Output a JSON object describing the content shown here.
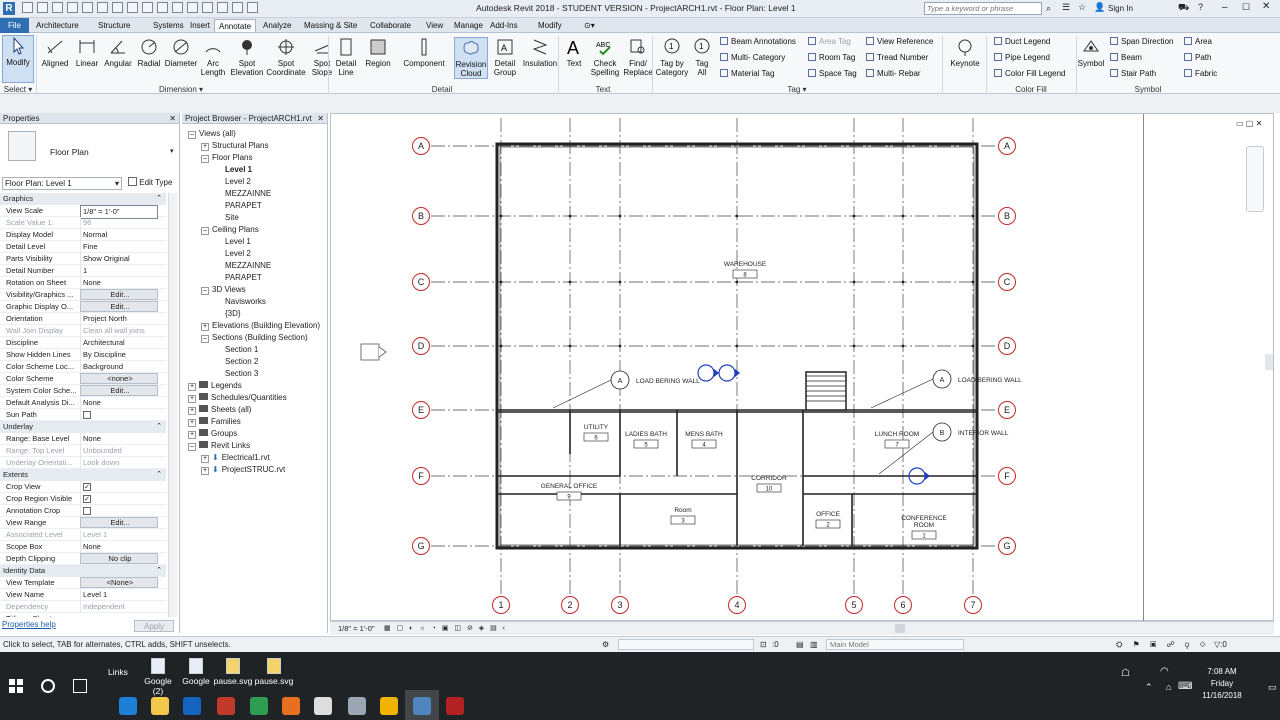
{
  "window": {
    "title": "Autodesk Revit 2018 -  STUDENT VERSION -    ProjectARCH1.rvt - Floor Plan: Level 1",
    "search_placeholder": "Type a keyword or phrase",
    "sign_in": "Sign In"
  },
  "tabs": [
    "File",
    "Architecture",
    "Structure",
    "Systems",
    "Insert",
    "Annotate",
    "Analyze",
    "Massing & Site",
    "Collaborate",
    "View",
    "Manage",
    "Add-Ins",
    "Modify"
  ],
  "active_tab": "Annotate",
  "ribbon": {
    "modify": "Modify",
    "select": "Select",
    "dimension_tools": [
      "Aligned",
      "Linear",
      "Angular",
      "Radial",
      "Diameter",
      "Arc\nLength",
      "Spot\nElevation",
      "Spot\nCoordinate",
      "Spot\nSlope"
    ],
    "dimension_panel": "Dimension",
    "detail_tools": [
      "Detail\nLine",
      "Region",
      "Component",
      "Revision\nCloud",
      "Detail\nGroup",
      "Insulation"
    ],
    "detail_panel": "Detail",
    "text_tools": [
      "Text",
      "Check\nSpelling",
      "Find/\nReplace"
    ],
    "text_panel": "Text",
    "tag_tools": [
      "Tag by\nCategory",
      "Tag\nAll"
    ],
    "tag_small": [
      "Beam  Annotations",
      "Multi- Category",
      "Material  Tag",
      "Area  Tag",
      "Room  Tag",
      "Space  Tag",
      "View  Reference",
      "Tread  Number",
      "Multi- Rebar"
    ],
    "tag_panel": "Tag",
    "keynote": "Keynote",
    "color_fill_small": [
      "Duct  Legend",
      "Pipe  Legend",
      "Color Fill  Legend"
    ],
    "color_fill_panel": "Color Fill",
    "symbol": "Symbol",
    "symbol_small": [
      "Span  Direction",
      "Beam",
      "Stair  Path",
      "Area",
      "Path",
      "Fabric"
    ],
    "symbol_panel": "Symbol"
  },
  "properties": {
    "title": "Properties",
    "type_name": "Floor Plan",
    "instance": "Floor Plan: Level 1",
    "edit_type": "Edit Type",
    "sections": [
      {
        "name": "Graphics",
        "rows": [
          [
            "View Scale",
            "1/8\" = 1'-0\"",
            0
          ],
          [
            "Scale Value    1:",
            "96",
            1
          ],
          [
            "Display Model",
            "Normal",
            0
          ],
          [
            "Detail Level",
            "Fine",
            0
          ],
          [
            "Parts Visibility",
            "Show Original",
            0
          ],
          [
            "Detail Number",
            "1",
            0
          ],
          [
            "Rotation on Sheet",
            "None",
            0
          ],
          [
            "Visibility/Graphics ...",
            "Edit...",
            2
          ],
          [
            "Graphic Display O...",
            "Edit...",
            2
          ],
          [
            "Orientation",
            "Project North",
            0
          ],
          [
            "Wall Join Display",
            "Clean all wall joins",
            1
          ],
          [
            "Discipline",
            "Architectural",
            0
          ],
          [
            "Show Hidden Lines",
            "By Discipline",
            0
          ],
          [
            "Color Scheme Loc...",
            "Background",
            0
          ],
          [
            "Color Scheme",
            "<none>",
            2
          ],
          [
            "System Color Sche...",
            "Edit...",
            2
          ],
          [
            "Default Analysis Di...",
            "None",
            0
          ],
          [
            "Sun Path",
            "",
            3
          ]
        ]
      },
      {
        "name": "Underlay",
        "rows": [
          [
            "Range: Base Level",
            "None",
            0
          ],
          [
            "Range: Top Level",
            "Unbounded",
            1
          ],
          [
            "Underlay Orientati...",
            "Look down",
            1
          ]
        ]
      },
      {
        "name": "Extents",
        "rows": [
          [
            "Crop View",
            "",
            4
          ],
          [
            "Crop Region Visible",
            "",
            4
          ],
          [
            "Annotation Crop",
            "",
            3
          ],
          [
            "View Range",
            "Edit...",
            2
          ],
          [
            "Associated Level",
            "Level 1",
            1
          ],
          [
            "Scope Box",
            "None",
            0
          ],
          [
            "Depth Clipping",
            "No clip",
            2
          ]
        ]
      },
      {
        "name": "Identity Data",
        "rows": [
          [
            "View Template",
            "<None>",
            2
          ],
          [
            "View Name",
            "Level 1",
            0
          ],
          [
            "Dependency",
            "Independent",
            1
          ],
          [
            "Title on Sheet",
            "",
            0
          ]
        ]
      }
    ],
    "help": "Properties help",
    "apply": "Apply"
  },
  "browser": {
    "title": "Project Browser - ProjectARCH1.rvt",
    "nodes": [
      [
        "Views (all)",
        0,
        0
      ],
      [
        "Structural Plans",
        1,
        0
      ],
      [
        "Floor Plans",
        1,
        0
      ],
      [
        "Level 1",
        2,
        1
      ],
      [
        "Level 2",
        2,
        0
      ],
      [
        "MEZZAINNE",
        2,
        0
      ],
      [
        "PARAPET",
        2,
        0
      ],
      [
        "Site",
        2,
        0
      ],
      [
        "Ceiling Plans",
        1,
        0
      ],
      [
        "Level 1",
        2,
        0
      ],
      [
        "Level 2",
        2,
        0
      ],
      [
        "MEZZAINNE",
        2,
        0
      ],
      [
        "PARAPET",
        2,
        0
      ],
      [
        "3D Views",
        1,
        0
      ],
      [
        "Navisworks",
        2,
        0
      ],
      [
        "{3D}",
        2,
        0
      ],
      [
        "Elevations (Building Elevation)",
        1,
        0
      ],
      [
        "Sections (Building Section)",
        1,
        0
      ],
      [
        "Section 1",
        2,
        0
      ],
      [
        "Section 2",
        2,
        0
      ],
      [
        "Section 3",
        2,
        0
      ],
      [
        "Legends",
        0,
        0
      ],
      [
        "Schedules/Quantities",
        0,
        0
      ],
      [
        "Sheets (all)",
        0,
        0
      ],
      [
        "Families",
        0,
        0
      ],
      [
        "Groups",
        0,
        0
      ],
      [
        "Revit Links",
        0,
        0
      ],
      [
        "Electrical1.rvt",
        1,
        0
      ],
      [
        "ProjectSTRUC.rvt",
        1,
        0
      ]
    ]
  },
  "plan": {
    "grid_letters": [
      "A",
      "B",
      "C",
      "D",
      "E",
      "F",
      "G"
    ],
    "grid_numbers": [
      "1",
      "2",
      "3",
      "4",
      "5",
      "6",
      "7"
    ],
    "rooms": [
      {
        "name": "WAREHOUSE",
        "num": "8"
      },
      {
        "name": "UTILITY",
        "num": "6"
      },
      {
        "name": "LADIES BATH",
        "num": "5"
      },
      {
        "name": "MENS BATH",
        "num": "4"
      },
      {
        "name": "LUNCH ROOM",
        "num": "7"
      },
      {
        "name": "GENERAL OFFICE",
        "num": "9"
      },
      {
        "name": "CORRIDOR",
        "num": "10"
      },
      {
        "name": "Room",
        "num": "3"
      },
      {
        "name": "OFFICE",
        "num": "2"
      },
      {
        "name": "CONFERENCE\nROOM",
        "num": "1"
      }
    ],
    "wall_tags": [
      {
        "letter": "A",
        "text": "LOAD BERING WALL"
      },
      {
        "letter": "A",
        "text": "LOAD BERING WALL"
      },
      {
        "letter": "B",
        "text": "INTERIOR WALL"
      }
    ]
  },
  "viewbar": {
    "scale": "1/8\" = 1'-0\""
  },
  "status": {
    "hint": "Click to select, TAB for alternates, CTRL adds, SHIFT unselects.",
    "zero": ":0",
    "model": "Main Model"
  },
  "taskbar": {
    "links_label": "Links",
    "desktop_items": [
      "Google (2)",
      "Google",
      "pause.svg",
      "pause.svg"
    ],
    "time": "7:08 AM",
    "day": "Friday",
    "date": "11/16/2018"
  },
  "colors": {
    "accent": "#2f6eb3",
    "grid_bubble": "#c62828",
    "wall": "#222222"
  }
}
